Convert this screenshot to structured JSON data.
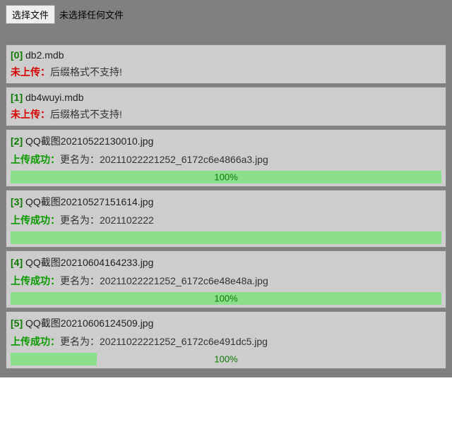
{
  "file_picker": {
    "choose_label": "选择文件",
    "no_file_label": "未选择任何文件"
  },
  "labels": {
    "fail_status": "未上传：",
    "ok_status": "上传成功：",
    "rename_prefix": "更名为："
  },
  "items": [
    {
      "index": "[0]",
      "filename": "db2.mdb",
      "success": false,
      "message": "后缀格式不支持!",
      "progress_percent": null,
      "progress_width": null,
      "progress_text": ""
    },
    {
      "index": "[1]",
      "filename": "db4wuyi.mdb",
      "success": false,
      "message": "后缀格式不支持!",
      "progress_percent": null,
      "progress_width": null,
      "progress_text": ""
    },
    {
      "index": "[2]",
      "filename": "QQ截图20210522130010.jpg",
      "success": true,
      "message": "更名为：20211022221252_6172c6e4866a3.jpg",
      "progress_percent": 100,
      "progress_width": 100,
      "progress_text": "100%"
    },
    {
      "index": "[3]",
      "filename": "QQ截图20210527151614.jpg",
      "success": true,
      "message": "更名为：2021102222",
      "progress_percent": 100,
      "progress_width": 100,
      "progress_text": ""
    },
    {
      "index": "[4]",
      "filename": "QQ截图20210604164233.jpg",
      "success": true,
      "message": "更名为：20211022221252_6172c6e48e48a.jpg",
      "progress_percent": 100,
      "progress_width": 100,
      "progress_text": "100%"
    },
    {
      "index": "[5]",
      "filename": "QQ截图20210606124509.jpg",
      "success": true,
      "message": "更名为：20211022221252_6172c6e491dc5.jpg",
      "progress_percent": 20,
      "progress_width": 20,
      "progress_text": "100%"
    }
  ]
}
